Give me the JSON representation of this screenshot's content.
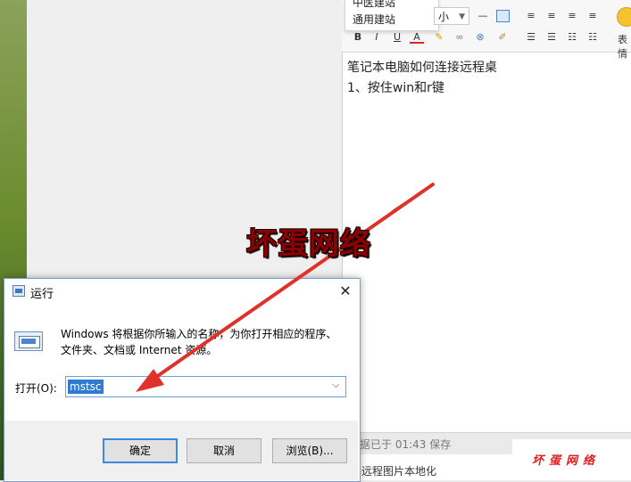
{
  "dropdown": {
    "items": [
      "中医建站",
      "通用建站"
    ]
  },
  "toolbar": {
    "font_size": "小",
    "buttons": [
      "B",
      "I",
      "U",
      "A"
    ],
    "emoji_label": "表情"
  },
  "editor": {
    "lines": [
      "笔记本电脑如何连接远程桌",
      "1、按住win和r键"
    ]
  },
  "status": {
    "saved_text": "据已于 01:43 保存",
    "footer_label": "远程图片本地化"
  },
  "watermark": {
    "big": "坏蛋网络",
    "small": "坏蛋网络"
  },
  "dialog": {
    "title": "运行",
    "close": "✕",
    "description": "Windows 将根据你所输入的名称，为你打开相应的程序、文件夹、文档或 Internet 资源。",
    "open_label": "打开(O):",
    "input_value": "mstsc",
    "ok": "确定",
    "cancel": "取消",
    "browse": "浏览(B)..."
  },
  "colors": {
    "accent": "#3b8ae0",
    "arrow": "#e0312a",
    "selection": "#2f7bd4"
  }
}
